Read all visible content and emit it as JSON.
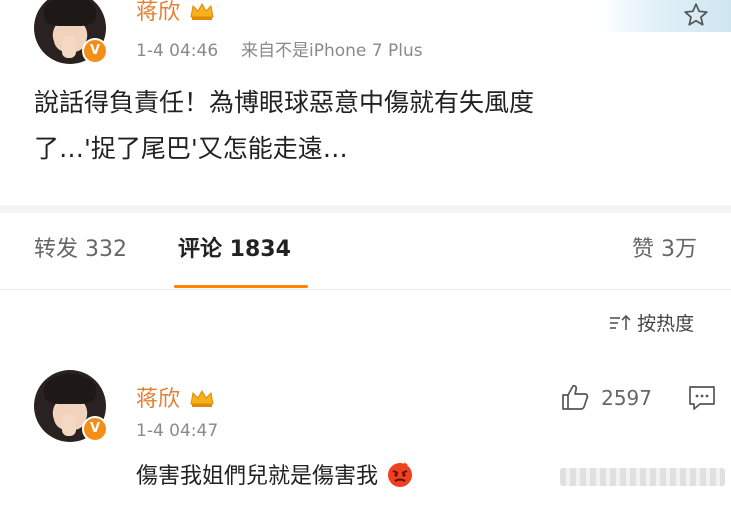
{
  "post": {
    "author_name": "蒋欣",
    "timestamp": "1-4 04:46",
    "source": "来自不是iPhone 7 Plus",
    "text_line1": "說話得負責任！為博眼球惡意中傷就有失風度",
    "text_line2": "了…'捉了尾巴'又怎能走遠…"
  },
  "stats": {
    "repost_label": "转发 332",
    "comment_label": "评论 1834",
    "like_label": "赞 3万"
  },
  "sort": {
    "label": "按热度"
  },
  "comment": {
    "author_name": "蒋欣",
    "timestamp": "1-4 04:47",
    "text": "傷害我姐們兒就是傷害我",
    "like_count": "2597"
  },
  "colors": {
    "accent": "#ff8200",
    "name": "#e57e31",
    "verified_badge": "#f38f17"
  },
  "icons": {
    "star": "star-icon",
    "verified": "verified-badge-icon",
    "crown": "crown-icon",
    "sort": "sort-icon",
    "like": "thumbs-up-icon",
    "reply": "comment-icon",
    "emoji": "angry-face-emoji-icon"
  }
}
